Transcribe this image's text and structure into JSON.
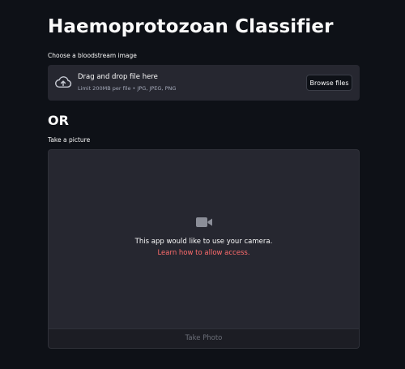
{
  "app": {
    "title": "Haemoprotozoan Classifier"
  },
  "uploader": {
    "label": "Choose a bloodstream image",
    "drop_text": "Drag and drop file here",
    "limit_text": "Limit 200MB per file • JPG, JPEG, PNG",
    "browse_label": "Browse files",
    "icon": "cloud-upload-icon"
  },
  "divider": {
    "text": "OR"
  },
  "camera": {
    "label": "Take a picture",
    "message": "This app would like to use your camera.",
    "link_text": "Learn how to allow access.",
    "button_label": "Take Photo",
    "icon": "video-camera-icon"
  },
  "colors": {
    "background": "#0e1117",
    "panel": "#262730",
    "text": "#fafafa",
    "muted": "#a3a8b8",
    "link": "#ff6c6c",
    "disabled": "#6b6e78"
  }
}
